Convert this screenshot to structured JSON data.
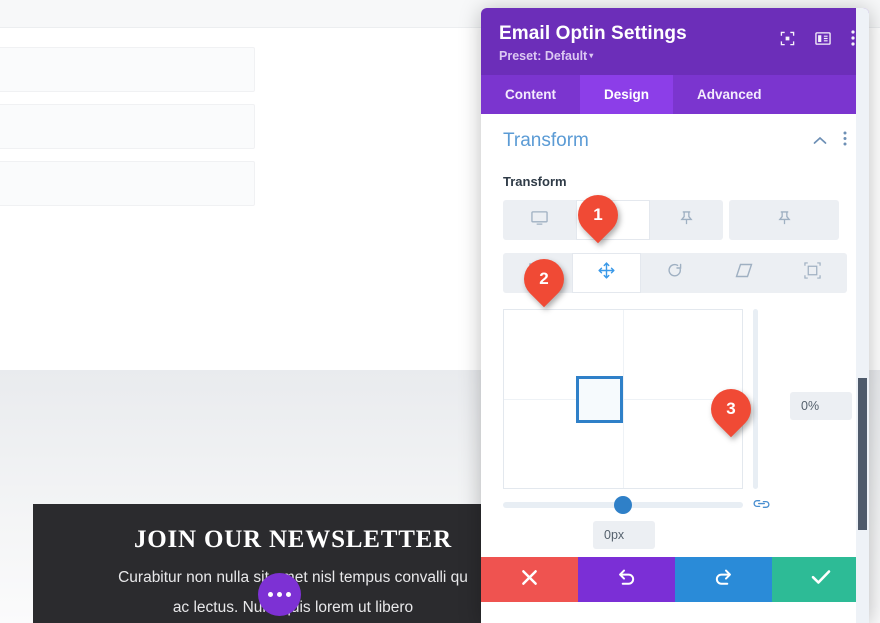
{
  "background": {
    "newsletter": {
      "heading": "JOIN OUR NEWSLETTER",
      "line1": "Curabitur non nulla sit amet nisl tempus convalli qu",
      "line2": "ac lectus. Nulla quis lorem ut libero"
    },
    "fab_name": "more-options-fab"
  },
  "modal": {
    "title": "Email Optin Settings",
    "preset": "Preset: Default",
    "preset_caret": "▾",
    "header_icons": [
      {
        "name": "focus-icon"
      },
      {
        "name": "layout-panel-icon"
      },
      {
        "name": "more-vertical-icon"
      }
    ],
    "tabs": [
      {
        "label": "Content",
        "active": false
      },
      {
        "label": "Design",
        "active": true
      },
      {
        "label": "Advanced",
        "active": false
      }
    ],
    "section": {
      "title": "Transform",
      "collapse_icon": "chevron-up-icon",
      "menu_icon": "more-vertical-icon"
    },
    "field": {
      "label": "Transform",
      "device_states": [
        {
          "name": "desktop-view-button",
          "icon": "monitor-icon",
          "active": false
        },
        {
          "name": "hover-state-button",
          "icon": "cursor-arrow-icon",
          "active": true
        },
        {
          "name": "sticky-state-button",
          "icon": "pin-icon",
          "active": false
        }
      ],
      "transform_types": [
        {
          "name": "scale-tab",
          "icon": "scale-icon",
          "active": false
        },
        {
          "name": "translate-tab",
          "icon": "move-arrows-icon",
          "active": true
        },
        {
          "name": "rotate-tab",
          "icon": "rotate-icon",
          "active": false
        },
        {
          "name": "skew-tab",
          "icon": "skew-icon",
          "active": false
        },
        {
          "name": "origin-tab",
          "icon": "origin-icon",
          "active": false
        }
      ],
      "vertical_value": "0%",
      "horizontal_value": "0px",
      "link_icon": "link-axes-icon"
    },
    "footer_buttons": [
      {
        "name": "cancel-button",
        "icon": "close-x-icon",
        "color": "#ef5350"
      },
      {
        "name": "undo-button",
        "icon": "undo-icon",
        "color": "#7b2fd6"
      },
      {
        "name": "redo-button",
        "icon": "redo-icon",
        "color": "#2a8bd8"
      },
      {
        "name": "save-button",
        "icon": "check-icon",
        "color": "#2dbb96"
      }
    ]
  },
  "markers": [
    {
      "label": "1"
    },
    {
      "label": "2"
    },
    {
      "label": "3"
    }
  ]
}
